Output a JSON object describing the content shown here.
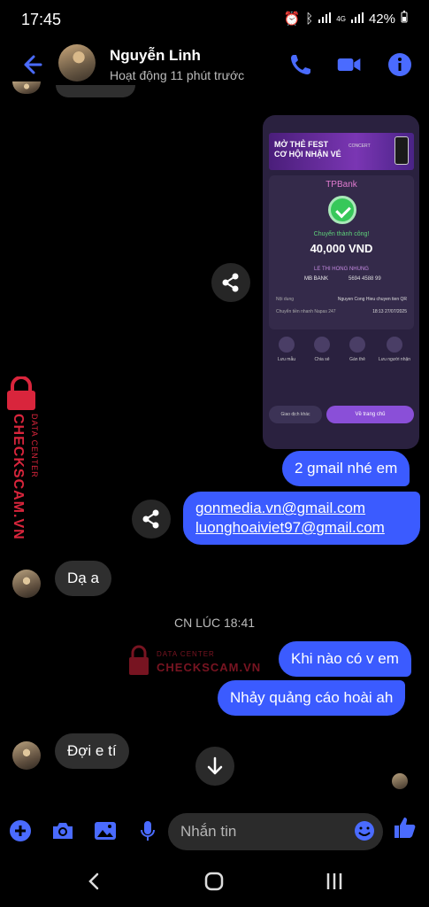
{
  "status_bar": {
    "time": "17:45",
    "network": "4G",
    "battery": "42%"
  },
  "header": {
    "contact_name": "Nguyễn Linh",
    "active_status": "Hoạt động 11 phút trước"
  },
  "receipt": {
    "banner_text_line1": "MỞ THẺ FEST",
    "banner_text_line2": "CƠ HỘI NHẬN VÉ",
    "banner_logo": "CONCERT",
    "bank_brand": "TPBank",
    "success_text": "Chuyển thành công!",
    "amount": "40,000 VND",
    "recipient": "LE THI HONG NHUNG",
    "recipient_bank": "MB BANK",
    "account": "5694 4588 99",
    "content_label": "Nội dung",
    "content_value": "Nguyen Cong Hieu chuyen tien QR",
    "transfer_label": "Chuyển tiền nhanh Napas 247",
    "transfer_time": "18:13 27/07/2025",
    "actions": [
      "Lưu mẫu",
      "Chia sẻ",
      "Gán thẻ",
      "Lưu người nhận"
    ],
    "button_secondary": "Giao dịch khác",
    "button_primary": "Về trang chủ"
  },
  "messages": {
    "out_1": "2 gmail nhé em",
    "out_2_line1": "gonmedia.vn@gmail.com",
    "out_2_line2": "luonghoaiviet97@gmail.com",
    "in_1": "Dạ a",
    "timestamp": "CN LÚC 18:41",
    "out_3": "Khi nào có v em",
    "out_4": "Nhảy quảng cáo hoài ah",
    "in_2": "Đợi e tí"
  },
  "watermark": {
    "label_top": "DATA CENTER",
    "label_main": "CHECKSCAM.VN"
  },
  "composer": {
    "placeholder": "Nhắn tin"
  },
  "colors": {
    "accent": "#3b5bff",
    "incoming_bubble": "#2f2f2f",
    "background": "#000000",
    "watermark_red": "#d9253c"
  }
}
